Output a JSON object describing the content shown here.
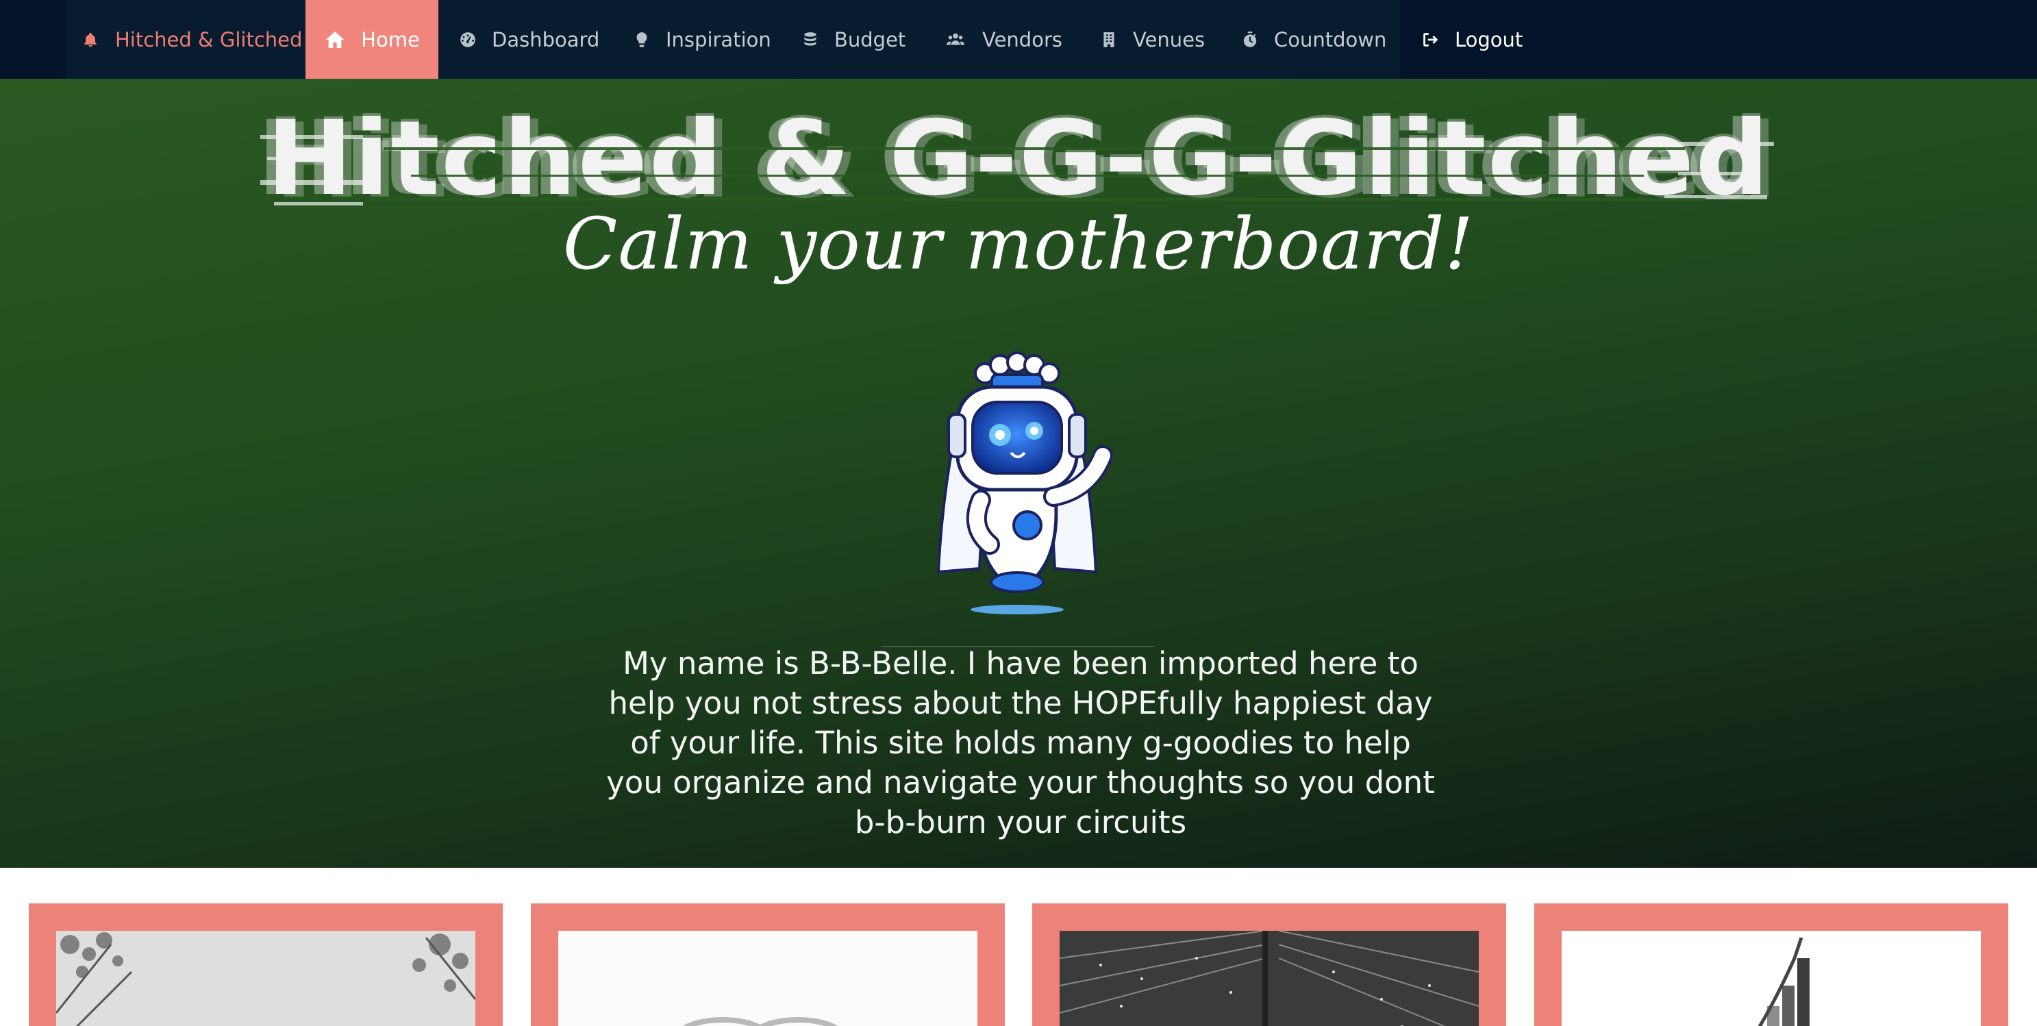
{
  "nav": {
    "brand": "Hitched & Glitched",
    "items": [
      {
        "label": "Home",
        "icon": "home-icon",
        "active": true
      },
      {
        "label": "Dashboard",
        "icon": "gauge-icon"
      },
      {
        "label": "Inspiration",
        "icon": "lightbulb-icon"
      },
      {
        "label": "Budget",
        "icon": "coins-icon"
      },
      {
        "label": "Vendors",
        "icon": "users-icon"
      },
      {
        "label": "Venues",
        "icon": "building-icon"
      },
      {
        "label": "Countdown",
        "icon": "stopwatch-icon"
      }
    ],
    "logout": "Logout"
  },
  "hero": {
    "title": "Hitched & G-G-G-Glitched",
    "tagline": "Calm your motherboard!",
    "description": "My name is B-B-Belle. I have been imported here to help you not stress about the HOPEfully happiest day of your life. This site holds many g-goodies to help you organize and navigate your thoughts so you dont b-b-burn your circuits"
  },
  "cards": [
    {
      "image": "trees-photo"
    },
    {
      "image": "rings-photo"
    },
    {
      "image": "lights-photo"
    },
    {
      "image": "chart-photo"
    }
  ],
  "colors": {
    "nav_bg": "#03132a",
    "accent": "#f0867b",
    "hero_green": "#224d1f"
  }
}
